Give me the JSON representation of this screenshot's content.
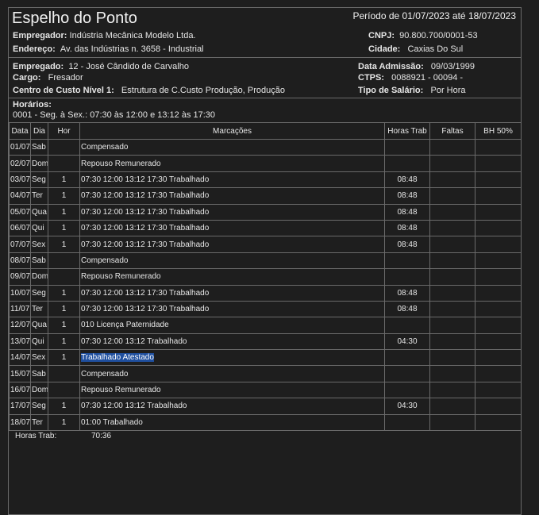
{
  "header": {
    "title": "Espelho do Ponto",
    "period": "Período de 01/07/2023 até 18/07/2023",
    "empregador_label": "Empregador:",
    "empregador": "Indústria Mecânica Modelo Ltda.",
    "cnpj_label": "CNPJ:",
    "cnpj": "90.800.700/0001-53",
    "endereco_label": "Endereço:",
    "endereco": "Av. das Indústrias n. 3658 - Industrial",
    "cidade_label": "Cidade:",
    "cidade": "Caxias Do Sul"
  },
  "employee": {
    "empregado_label": "Empregado:",
    "empregado": "12 - José Cândido de Carvalho",
    "admissao_label": "Data Admissão:",
    "admissao": "09/03/1999",
    "cargo_label": "Cargo:",
    "cargo": "Fresador",
    "ctps_label": "CTPS:",
    "ctps": "0088921 - 00094 -",
    "centro_label": "Centro de Custo Nível 1:",
    "centro": "Estrutura de C.Custo Produção, Produção",
    "salario_label": "Tipo de Salário:",
    "salario": "Por Hora"
  },
  "horarios": {
    "label": "Horários:",
    "value": "0001 - Seg. à Sex.: 07:30 às 12:00  e  13:12 às 17:30"
  },
  "table": {
    "headers": [
      "Data",
      "Dia",
      "Hor",
      "Marcações",
      "Horas Trab",
      "Faltas",
      "BH 50%"
    ],
    "rows": [
      {
        "data": "01/07",
        "dia": "Sab",
        "hor": "",
        "marc": "Compensado",
        "horas": "",
        "faltas": "",
        "bh": ""
      },
      {
        "data": "02/07",
        "dia": "Dom",
        "hor": "",
        "marc": "Repouso Remunerado",
        "horas": "",
        "faltas": "",
        "bh": ""
      },
      {
        "data": "03/07",
        "dia": "Seg",
        "hor": "1",
        "marc": "07:30 12:00 13:12 17:30 Trabalhado",
        "horas": "08:48",
        "faltas": "",
        "bh": ""
      },
      {
        "data": "04/07",
        "dia": "Ter",
        "hor": "1",
        "marc": "07:30 12:00 13:12 17:30 Trabalhado",
        "horas": "08:48",
        "faltas": "",
        "bh": ""
      },
      {
        "data": "05/07",
        "dia": "Qua",
        "hor": "1",
        "marc": "07:30 12:00 13:12 17:30 Trabalhado",
        "horas": "08:48",
        "faltas": "",
        "bh": ""
      },
      {
        "data": "06/07",
        "dia": "Qui",
        "hor": "1",
        "marc": "07:30 12:00 13:12 17:30 Trabalhado",
        "horas": "08:48",
        "faltas": "",
        "bh": ""
      },
      {
        "data": "07/07",
        "dia": "Sex",
        "hor": "1",
        "marc": "07:30 12:00 13:12 17:30 Trabalhado",
        "horas": "08:48",
        "faltas": "",
        "bh": ""
      },
      {
        "data": "08/07",
        "dia": "Sab",
        "hor": "",
        "marc": "Compensado",
        "horas": "",
        "faltas": "",
        "bh": ""
      },
      {
        "data": "09/07",
        "dia": "Dom",
        "hor": "",
        "marc": "Repouso Remunerado",
        "horas": "",
        "faltas": "",
        "bh": ""
      },
      {
        "data": "10/07",
        "dia": "Seg",
        "hor": "1",
        "marc": "07:30 12:00 13:12 17:30 Trabalhado",
        "horas": "08:48",
        "faltas": "",
        "bh": ""
      },
      {
        "data": "11/07",
        "dia": "Ter",
        "hor": "1",
        "marc": "07:30 12:00 13:12 17:30 Trabalhado",
        "horas": "08:48",
        "faltas": "",
        "bh": ""
      },
      {
        "data": "12/07",
        "dia": "Qua",
        "hor": "1",
        "marc": "010  Licença Paternidade",
        "horas": "",
        "faltas": "",
        "bh": ""
      },
      {
        "data": "13/07",
        "dia": "Qui",
        "hor": "1",
        "marc": "07:30 12:00 13:12 Trabalhado",
        "horas": "04:30",
        "faltas": "",
        "bh": ""
      },
      {
        "data": "14/07",
        "dia": "Sex",
        "hor": "1",
        "marc": "Trabalhado  Atestado",
        "horas": "",
        "faltas": "",
        "bh": "",
        "highlight": true
      },
      {
        "data": "15/07",
        "dia": "Sab",
        "hor": "",
        "marc": "Compensado",
        "horas": "",
        "faltas": "",
        "bh": ""
      },
      {
        "data": "16/07",
        "dia": "Dom",
        "hor": "",
        "marc": "Repouso Remunerado",
        "horas": "",
        "faltas": "",
        "bh": ""
      },
      {
        "data": "17/07",
        "dia": "Seg",
        "hor": "1",
        "marc": "07:30 12:00 13:12 Trabalhado",
        "horas": "04:30",
        "faltas": "",
        "bh": ""
      },
      {
        "data": "18/07",
        "dia": "Ter",
        "hor": "1",
        "marc": "01:00 Trabalhado",
        "horas": "",
        "faltas": "",
        "bh": ""
      }
    ]
  },
  "footer": {
    "horas_trab_label": "Horas Trab:",
    "horas_trab_value": "70:36"
  },
  "colors": {
    "background": "#1e1e1e",
    "text": "#e6e6e6",
    "grid": "#6a6a6a",
    "highlight": "#1f4f9e"
  }
}
